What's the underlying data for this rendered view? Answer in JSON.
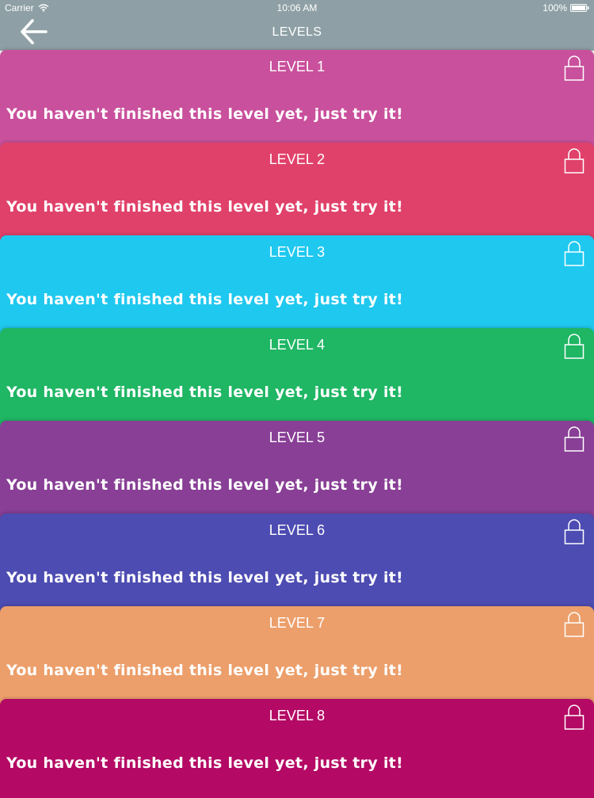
{
  "status_bar": {
    "carrier": "Carrier",
    "time": "10:06 AM",
    "battery": "100%",
    "icons": {
      "wifi": "wifi-icon",
      "battery": "battery-icon"
    }
  },
  "nav": {
    "title": "LEVELS",
    "back_icon": "arrow-left-icon"
  },
  "theme": {
    "header_color": "#8ea0a5"
  },
  "levels": [
    {
      "title": "LEVEL 1",
      "message": "You haven't finished this level yet, just try it!",
      "color": "#c9509c",
      "locked": true
    },
    {
      "title": "LEVEL 2",
      "message": "You haven't finished this level yet, just try it!",
      "color": "#e0416a",
      "locked": true
    },
    {
      "title": "LEVEL 3",
      "message": "You haven't finished this level yet, just try it!",
      "color": "#1fc8ef",
      "locked": true
    },
    {
      "title": "LEVEL 4",
      "message": "You haven't finished this level yet, just try it!",
      "color": "#1fb664",
      "locked": true
    },
    {
      "title": "LEVEL 5",
      "message": "You haven't finished this level yet, just try it!",
      "color": "#883f95",
      "locked": true
    },
    {
      "title": "LEVEL 6",
      "message": "You haven't finished this level yet, just try it!",
      "color": "#4d4cb2",
      "locked": true
    },
    {
      "title": "LEVEL 7",
      "message": "You haven't finished this level yet, just try it!",
      "color": "#ec9f6b",
      "locked": true
    },
    {
      "title": "LEVEL 8",
      "message": "You haven't finished this level yet, just try it!",
      "color": "#b40964",
      "locked": true
    }
  ]
}
